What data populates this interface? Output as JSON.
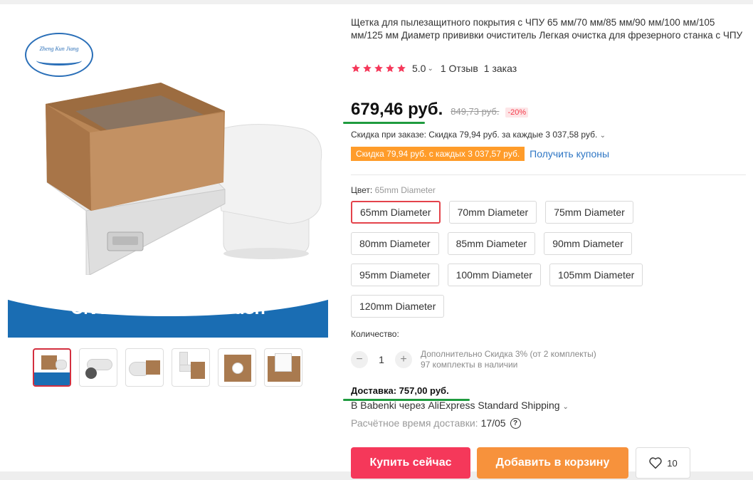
{
  "product": {
    "title": "Щетка для пылезащитного покрытия с ЧПУ 65 мм/70 мм/85 мм/90 мм/100 мм/105 мм/125 мм Диаметр прививки очиститель Легкая очистка для фрезерного станка с ЧПУ",
    "image_caption": "CNC Dust Cover Brush",
    "logo_text": "Zheng Kun Jiang"
  },
  "rating": {
    "value": "5.0",
    "stars": 5,
    "reviews": "1 Отзыв",
    "orders": "1 заказ",
    "star_color": "#f5385a"
  },
  "price": {
    "current": "679,46 руб.",
    "old": "849,73 руб.",
    "discount": "-20%"
  },
  "promo": {
    "order_discount": "Скидка при заказе: Скидка 79,94 руб. за каждые 3 037,58 руб.",
    "coupon_tag": "Скидка 79,94 руб. с каждых 3 037,57 руб.",
    "coupon_link": "Получить купоны"
  },
  "variants": {
    "label": "Цвет:",
    "selected": "65mm Diameter",
    "options": [
      "65mm Diameter",
      "70mm Diameter",
      "75mm Diameter",
      "80mm Diameter",
      "85mm Diameter",
      "90mm Diameter",
      "95mm Diameter",
      "100mm Diameter",
      "105mm Diameter",
      "120mm Diameter"
    ]
  },
  "quantity": {
    "label": "Количество:",
    "value": "1",
    "minus": "−",
    "plus": "+",
    "bulk_note": "Дополнительно Скидка 3% (от 2 комплекты)",
    "stock": "97 комплекты в наличии"
  },
  "delivery": {
    "title": "Доставка: 757,00 руб.",
    "method": "В Babenki через AliExpress Standard Shipping",
    "eta_label": "Расчётное время доставки:",
    "eta_date": "17/05",
    "help": "?"
  },
  "actions": {
    "buy": "Купить сейчас",
    "cart": "Добавить в корзину",
    "wishlist_count": "10"
  },
  "colors": {
    "buy_button": "#f5385a",
    "cart_button": "#f7923c",
    "coupon": "#ff9c2a",
    "highlight_underline": "#1f9b3f",
    "image_blue": "#1a6db3",
    "link": "#2e76c4"
  },
  "icons": {
    "star": "star-icon",
    "chevron": "chevron-down-icon",
    "heart": "heart-icon",
    "help": "question-circle-icon"
  }
}
